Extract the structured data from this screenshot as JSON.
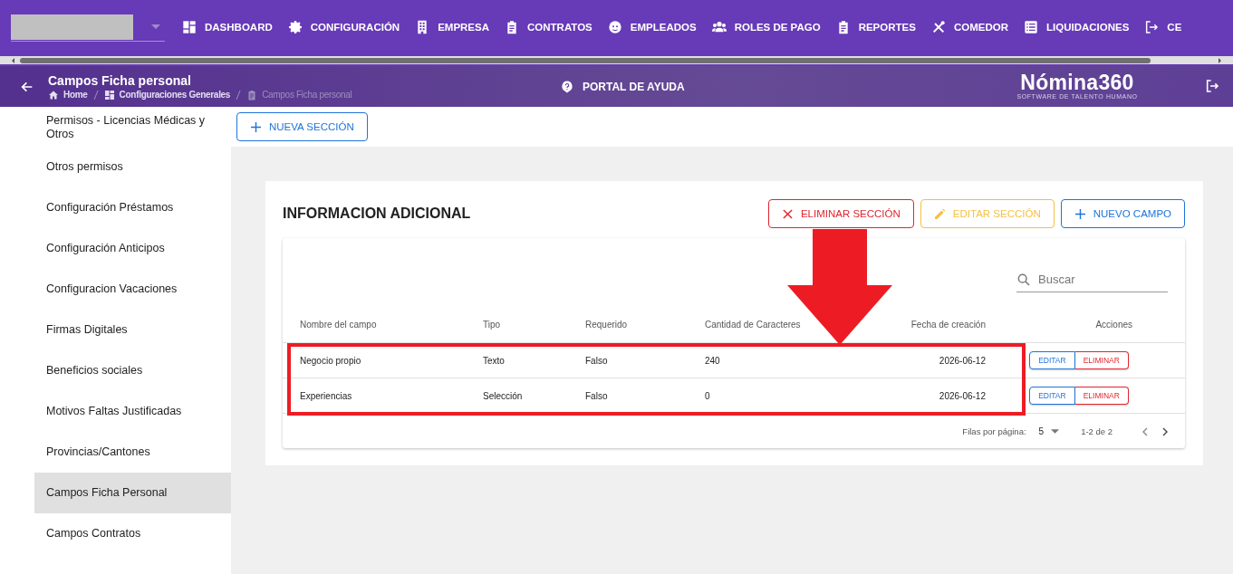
{
  "nav": {
    "items": [
      {
        "label": "DASHBOARD"
      },
      {
        "label": "CONFIGURACIÓN"
      },
      {
        "label": "EMPRESA"
      },
      {
        "label": "CONTRATOS"
      },
      {
        "label": "EMPLEADOS"
      },
      {
        "label": "ROLES DE PAGO"
      },
      {
        "label": "REPORTES"
      },
      {
        "label": "COMEDOR"
      },
      {
        "label": "LIQUIDACIONES"
      },
      {
        "label": "CE"
      }
    ]
  },
  "header": {
    "title": "Campos Ficha personal",
    "breadcrumbs": [
      {
        "label": "Home",
        "current": false
      },
      {
        "label": "Configuraciones Generales",
        "current": false
      },
      {
        "label": "Campos Ficha personal",
        "current": true
      }
    ],
    "help": "PORTAL DE AYUDA",
    "logo": "Nómina360",
    "logo_tagline": "SOFTWARE DE TALENTO HUMANO"
  },
  "sidebar": {
    "items": [
      {
        "label": "Permisos - Licencias Médicas y Otros",
        "selected": false
      },
      {
        "label": "Otros permisos",
        "selected": false
      },
      {
        "label": "Configuración Préstamos",
        "selected": false
      },
      {
        "label": "Configuración Anticipos",
        "selected": false
      },
      {
        "label": "Configuracion Vacaciones",
        "selected": false
      },
      {
        "label": "Firmas Digitales",
        "selected": false
      },
      {
        "label": "Beneficios sociales",
        "selected": false
      },
      {
        "label": "Motivos Faltas Justificadas",
        "selected": false
      },
      {
        "label": "Provincias/Cantones",
        "selected": false
      },
      {
        "label": "Campos Ficha Personal",
        "selected": true
      },
      {
        "label": "Campos Contratos",
        "selected": false
      }
    ]
  },
  "toolbar": {
    "new_section": "NUEVA SECCIÓN"
  },
  "section": {
    "title": "INFORMACION ADICIONAL",
    "buttons": [
      {
        "label": "ELIMINAR SECCIÓN",
        "kind": "danger"
      },
      {
        "label": "EDITAR SECCIÓN",
        "kind": "warning"
      },
      {
        "label": "NUEVO CAMPO",
        "kind": "primary"
      }
    ],
    "search": {
      "placeholder": "Buscar"
    },
    "table": {
      "columns": [
        "Nombre del campo",
        "Tipo",
        "Requerido",
        "Cantidad de Caracteres",
        "Fecha de creación",
        "Acciones"
      ],
      "rows": [
        {
          "cells": [
            "Negocio propio",
            "Texto",
            "Falso",
            "240",
            "2026-06-12"
          ],
          "actions": [
            "EDITAR",
            "ELIMINAR"
          ]
        },
        {
          "cells": [
            "Experiencias",
            "Selección",
            "Falso",
            "0",
            "2026-06-12"
          ],
          "actions": [
            "EDITAR",
            "ELIMINAR"
          ]
        }
      ]
    },
    "pagination": {
      "rows_per_page_label": "Filas por página:",
      "rows_per_page": "5",
      "range": "1-2 de 2"
    }
  }
}
